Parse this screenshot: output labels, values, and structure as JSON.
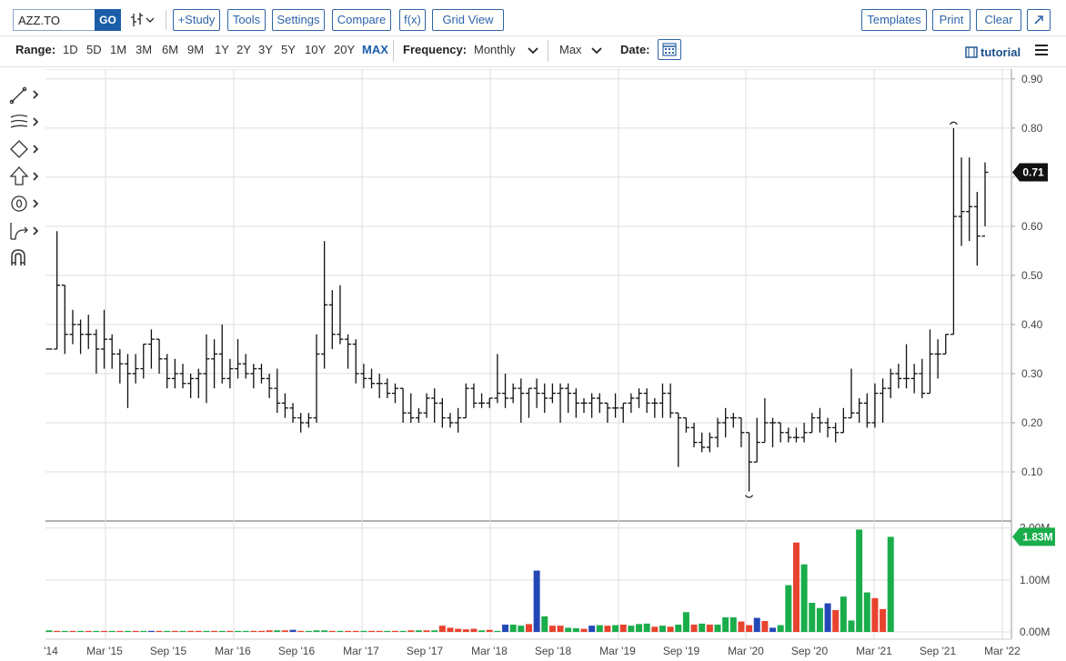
{
  "toolbar": {
    "symbol": "AZZ.TO",
    "go_label": "GO",
    "study_label": "+Study",
    "tools_label": "Tools",
    "settings_label": "Settings",
    "compare_label": "Compare",
    "fx_label": "f(x)",
    "gridview_label": "Grid View",
    "templates_label": "Templates",
    "print_label": "Print",
    "clear_label": "Clear"
  },
  "rangebar": {
    "range_label": "Range:",
    "ranges": [
      "1D",
      "5D",
      "1M",
      "3M",
      "6M",
      "9M",
      "1Y",
      "2Y",
      "3Y",
      "5Y",
      "10Y",
      "20Y",
      "MAX"
    ],
    "active_range": "MAX",
    "frequency_label": "Frequency:",
    "frequency_value": "Monthly",
    "period_value": "Max",
    "date_label": "Date:",
    "tutorial_label": "tutorial"
  },
  "colors": {
    "accent": "#1a5ea8",
    "up": "#1aad4b",
    "down": "#e8432e",
    "neutral": "#2447b8",
    "price_bar": "#111111",
    "grid": "#dddddd"
  },
  "drawing_tools": [
    "line-tool-icon",
    "fib-tool-icon",
    "shape-tool-icon",
    "arrow-tool-icon",
    "annotation-tool-icon",
    "measure-tool-icon",
    "magnet-icon"
  ],
  "chart_data": {
    "type": "ohlc-bar",
    "x_labels": [
      "'14",
      "Mar '15",
      "Sep '15",
      "Mar '16",
      "Sep '16",
      "Mar '17",
      "Sep '17",
      "Mar '18",
      "Sep '18",
      "Mar '19",
      "Sep '19",
      "Mar '20",
      "Sep '20",
      "Mar '21",
      "Sep '21",
      "Mar '22"
    ],
    "price_axis": {
      "ticks": [
        "0.90",
        "0.80",
        "0.70",
        "0.60",
        "0.50",
        "0.40",
        "0.30",
        "0.20",
        "0.10"
      ],
      "ylim": [
        0.0,
        0.92
      ]
    },
    "last_price": "0.71",
    "volume_axis": {
      "ticks": [
        "2.00M",
        "1.00M",
        "0.00M"
      ],
      "ylim": [
        0,
        2.1
      ]
    },
    "last_volume": "1.83M",
    "ohlc": [
      [
        0.35,
        0.35,
        0.35,
        0.35
      ],
      [
        0.35,
        0.59,
        0.35,
        0.48
      ],
      [
        0.48,
        0.48,
        0.34,
        0.38
      ],
      [
        0.38,
        0.43,
        0.36,
        0.4
      ],
      [
        0.4,
        0.41,
        0.34,
        0.38
      ],
      [
        0.38,
        0.42,
        0.35,
        0.38
      ],
      [
        0.38,
        0.39,
        0.3,
        0.35
      ],
      [
        0.35,
        0.43,
        0.31,
        0.37
      ],
      [
        0.37,
        0.38,
        0.31,
        0.34
      ],
      [
        0.34,
        0.35,
        0.28,
        0.32
      ],
      [
        0.32,
        0.34,
        0.23,
        0.3
      ],
      [
        0.3,
        0.34,
        0.28,
        0.31
      ],
      [
        0.31,
        0.36,
        0.29,
        0.36
      ],
      [
        0.36,
        0.39,
        0.31,
        0.37
      ],
      [
        0.37,
        0.37,
        0.3,
        0.33
      ],
      [
        0.33,
        0.34,
        0.27,
        0.29
      ],
      [
        0.29,
        0.33,
        0.27,
        0.3
      ],
      [
        0.3,
        0.32,
        0.27,
        0.28
      ],
      [
        0.28,
        0.3,
        0.25,
        0.29
      ],
      [
        0.29,
        0.31,
        0.25,
        0.3
      ],
      [
        0.3,
        0.38,
        0.24,
        0.33
      ],
      [
        0.33,
        0.37,
        0.27,
        0.34
      ],
      [
        0.34,
        0.4,
        0.28,
        0.29
      ],
      [
        0.29,
        0.33,
        0.27,
        0.31
      ],
      [
        0.31,
        0.37,
        0.29,
        0.32
      ],
      [
        0.32,
        0.34,
        0.29,
        0.3
      ],
      [
        0.3,
        0.32,
        0.27,
        0.31
      ],
      [
        0.31,
        0.32,
        0.28,
        0.29
      ],
      [
        0.29,
        0.3,
        0.25,
        0.27
      ],
      [
        0.27,
        0.31,
        0.22,
        0.24
      ],
      [
        0.24,
        0.26,
        0.21,
        0.23
      ],
      [
        0.23,
        0.24,
        0.2,
        0.21
      ],
      [
        0.21,
        0.22,
        0.18,
        0.2
      ],
      [
        0.2,
        0.22,
        0.19,
        0.21
      ],
      [
        0.21,
        0.38,
        0.2,
        0.34
      ],
      [
        0.34,
        0.57,
        0.31,
        0.44
      ],
      [
        0.44,
        0.47,
        0.35,
        0.38
      ],
      [
        0.38,
        0.48,
        0.36,
        0.37
      ],
      [
        0.37,
        0.38,
        0.31,
        0.36
      ],
      [
        0.36,
        0.37,
        0.28,
        0.3
      ],
      [
        0.3,
        0.32,
        0.27,
        0.29
      ],
      [
        0.29,
        0.31,
        0.27,
        0.28
      ],
      [
        0.28,
        0.3,
        0.25,
        0.28
      ],
      [
        0.28,
        0.29,
        0.25,
        0.26
      ],
      [
        0.26,
        0.28,
        0.24,
        0.27
      ],
      [
        0.27,
        0.27,
        0.2,
        0.22
      ],
      [
        0.22,
        0.26,
        0.2,
        0.21
      ],
      [
        0.21,
        0.23,
        0.2,
        0.22
      ],
      [
        0.22,
        0.26,
        0.21,
        0.25
      ],
      [
        0.25,
        0.27,
        0.2,
        0.24
      ],
      [
        0.24,
        0.25,
        0.19,
        0.21
      ],
      [
        0.21,
        0.22,
        0.19,
        0.2
      ],
      [
        0.2,
        0.23,
        0.18,
        0.21
      ],
      [
        0.21,
        0.28,
        0.21,
        0.27
      ],
      [
        0.27,
        0.28,
        0.23,
        0.24
      ],
      [
        0.24,
        0.26,
        0.23,
        0.24
      ],
      [
        0.24,
        0.25,
        0.23,
        0.25
      ],
      [
        0.25,
        0.34,
        0.24,
        0.26
      ],
      [
        0.26,
        0.3,
        0.23,
        0.25
      ],
      [
        0.25,
        0.28,
        0.24,
        0.27
      ],
      [
        0.27,
        0.29,
        0.2,
        0.26
      ],
      [
        0.26,
        0.27,
        0.21,
        0.27
      ],
      [
        0.27,
        0.29,
        0.23,
        0.26
      ],
      [
        0.26,
        0.28,
        0.22,
        0.25
      ],
      [
        0.25,
        0.28,
        0.24,
        0.26
      ],
      [
        0.26,
        0.28,
        0.2,
        0.27
      ],
      [
        0.27,
        0.28,
        0.22,
        0.26
      ],
      [
        0.26,
        0.27,
        0.21,
        0.24
      ],
      [
        0.24,
        0.25,
        0.22,
        0.24
      ],
      [
        0.24,
        0.26,
        0.21,
        0.25
      ],
      [
        0.25,
        0.26,
        0.22,
        0.24
      ],
      [
        0.24,
        0.24,
        0.2,
        0.23
      ],
      [
        0.23,
        0.26,
        0.21,
        0.23
      ],
      [
        0.23,
        0.24,
        0.2,
        0.24
      ],
      [
        0.24,
        0.26,
        0.22,
        0.25
      ],
      [
        0.25,
        0.27,
        0.23,
        0.26
      ],
      [
        0.26,
        0.27,
        0.22,
        0.24
      ],
      [
        0.24,
        0.25,
        0.21,
        0.24
      ],
      [
        0.24,
        0.28,
        0.21,
        0.26
      ],
      [
        0.26,
        0.28,
        0.21,
        0.22
      ],
      [
        0.22,
        0.22,
        0.11,
        0.21
      ],
      [
        0.21,
        0.21,
        0.18,
        0.19
      ],
      [
        0.19,
        0.2,
        0.15,
        0.16
      ],
      [
        0.16,
        0.18,
        0.14,
        0.15
      ],
      [
        0.15,
        0.18,
        0.14,
        0.17
      ],
      [
        0.17,
        0.21,
        0.15,
        0.2
      ],
      [
        0.2,
        0.23,
        0.17,
        0.21
      ],
      [
        0.21,
        0.22,
        0.19,
        0.21
      ],
      [
        0.21,
        0.21,
        0.15,
        0.18
      ],
      [
        0.18,
        0.18,
        0.06,
        0.12
      ],
      [
        0.12,
        0.21,
        0.12,
        0.16
      ],
      [
        0.16,
        0.25,
        0.16,
        0.2
      ],
      [
        0.2,
        0.21,
        0.15,
        0.2
      ],
      [
        0.2,
        0.2,
        0.16,
        0.18
      ],
      [
        0.18,
        0.19,
        0.16,
        0.17
      ],
      [
        0.17,
        0.19,
        0.16,
        0.17
      ],
      [
        0.17,
        0.2,
        0.16,
        0.18
      ],
      [
        0.18,
        0.22,
        0.18,
        0.21
      ],
      [
        0.21,
        0.23,
        0.18,
        0.2
      ],
      [
        0.2,
        0.21,
        0.17,
        0.19
      ],
      [
        0.19,
        0.2,
        0.16,
        0.18
      ],
      [
        0.18,
        0.23,
        0.18,
        0.21
      ],
      [
        0.21,
        0.31,
        0.21,
        0.22
      ],
      [
        0.22,
        0.25,
        0.2,
        0.24
      ],
      [
        0.24,
        0.26,
        0.19,
        0.2
      ],
      [
        0.2,
        0.28,
        0.19,
        0.26
      ],
      [
        0.26,
        0.29,
        0.2,
        0.27
      ],
      [
        0.27,
        0.31,
        0.25,
        0.3
      ],
      [
        0.3,
        0.32,
        0.27,
        0.29
      ],
      [
        0.29,
        0.36,
        0.27,
        0.29
      ],
      [
        0.29,
        0.32,
        0.26,
        0.3
      ],
      [
        0.3,
        0.33,
        0.25,
        0.26
      ],
      [
        0.26,
        0.39,
        0.26,
        0.34
      ],
      [
        0.34,
        0.37,
        0.29,
        0.34
      ],
      [
        0.34,
        0.38,
        0.34,
        0.38
      ],
      [
        0.38,
        0.8,
        0.38,
        0.62
      ],
      [
        0.62,
        0.74,
        0.56,
        0.63
      ],
      [
        0.63,
        0.74,
        0.57,
        0.64
      ],
      [
        0.64,
        0.67,
        0.52,
        0.58
      ],
      [
        0.58,
        0.73,
        0.6,
        0.71
      ]
    ],
    "volume": [
      [
        0.03,
        "u"
      ],
      [
        0.02,
        "d"
      ],
      [
        0.02,
        "u"
      ],
      [
        0.02,
        "d"
      ],
      [
        0.02,
        "u"
      ],
      [
        0.02,
        "d"
      ],
      [
        0.02,
        "u"
      ],
      [
        0.02,
        "d"
      ],
      [
        0.02,
        "u"
      ],
      [
        0.02,
        "d"
      ],
      [
        0.02,
        "u"
      ],
      [
        0.02,
        "d"
      ],
      [
        0.02,
        "u"
      ],
      [
        0.02,
        "n"
      ],
      [
        0.02,
        "d"
      ],
      [
        0.02,
        "u"
      ],
      [
        0.02,
        "d"
      ],
      [
        0.02,
        "u"
      ],
      [
        0.02,
        "d"
      ],
      [
        0.02,
        "d"
      ],
      [
        0.02,
        "u"
      ],
      [
        0.02,
        "d"
      ],
      [
        0.02,
        "u"
      ],
      [
        0.02,
        "d"
      ],
      [
        0.02,
        "u"
      ],
      [
        0.02,
        "u"
      ],
      [
        0.02,
        "d"
      ],
      [
        0.02,
        "d"
      ],
      [
        0.03,
        "d"
      ],
      [
        0.03,
        "u"
      ],
      [
        0.03,
        "d"
      ],
      [
        0.04,
        "n"
      ],
      [
        0.02,
        "d"
      ],
      [
        0.02,
        "u"
      ],
      [
        0.03,
        "u"
      ],
      [
        0.03,
        "u"
      ],
      [
        0.02,
        "d"
      ],
      [
        0.02,
        "u"
      ],
      [
        0.02,
        "d"
      ],
      [
        0.02,
        "d"
      ],
      [
        0.02,
        "u"
      ],
      [
        0.02,
        "d"
      ],
      [
        0.02,
        "d"
      ],
      [
        0.02,
        "u"
      ],
      [
        0.02,
        "d"
      ],
      [
        0.02,
        "u"
      ],
      [
        0.03,
        "d"
      ],
      [
        0.03,
        "u"
      ],
      [
        0.03,
        "d"
      ],
      [
        0.03,
        "u"
      ],
      [
        0.12,
        "d"
      ],
      [
        0.08,
        "d"
      ],
      [
        0.06,
        "d"
      ],
      [
        0.05,
        "d"
      ],
      [
        0.06,
        "d"
      ],
      [
        0.03,
        "u"
      ],
      [
        0.04,
        "d"
      ],
      [
        0.02,
        "u"
      ],
      [
        0.14,
        "n"
      ],
      [
        0.14,
        "u"
      ],
      [
        0.12,
        "u"
      ],
      [
        0.15,
        "d"
      ],
      [
        1.18,
        "n"
      ],
      [
        0.3,
        "u"
      ],
      [
        0.12,
        "d"
      ],
      [
        0.12,
        "d"
      ],
      [
        0.08,
        "u"
      ],
      [
        0.07,
        "u"
      ],
      [
        0.06,
        "d"
      ],
      [
        0.12,
        "n"
      ],
      [
        0.13,
        "u"
      ],
      [
        0.12,
        "d"
      ],
      [
        0.13,
        "u"
      ],
      [
        0.14,
        "d"
      ],
      [
        0.12,
        "u"
      ],
      [
        0.15,
        "u"
      ],
      [
        0.16,
        "u"
      ],
      [
        0.1,
        "d"
      ],
      [
        0.12,
        "u"
      ],
      [
        0.1,
        "d"
      ],
      [
        0.14,
        "u"
      ],
      [
        0.38,
        "u"
      ],
      [
        0.14,
        "d"
      ],
      [
        0.16,
        "u"
      ],
      [
        0.14,
        "d"
      ],
      [
        0.14,
        "u"
      ],
      [
        0.28,
        "u"
      ],
      [
        0.28,
        "u"
      ],
      [
        0.2,
        "d"
      ],
      [
        0.13,
        "d"
      ],
      [
        0.27,
        "n"
      ],
      [
        0.21,
        "d"
      ],
      [
        0.08,
        "n"
      ],
      [
        0.13,
        "u"
      ],
      [
        0.9,
        "u"
      ],
      [
        1.72,
        "d"
      ],
      [
        1.3,
        "u"
      ],
      [
        0.56,
        "u"
      ],
      [
        0.46,
        "u"
      ],
      [
        0.55,
        "n"
      ],
      [
        0.42,
        "d"
      ],
      [
        0.68,
        "u"
      ],
      [
        0.22,
        "u"
      ],
      [
        1.97,
        "u"
      ],
      [
        0.76,
        "u"
      ],
      [
        0.65,
        "d"
      ],
      [
        0.44,
        "d"
      ],
      [
        1.83,
        "u"
      ]
    ]
  }
}
